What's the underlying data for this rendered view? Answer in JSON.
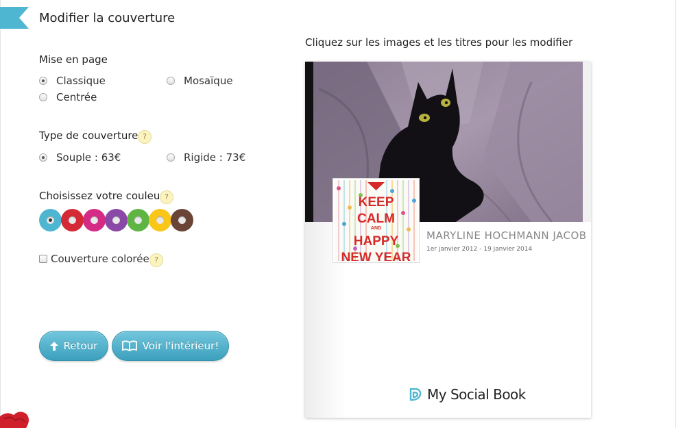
{
  "header": {
    "title": "Modifier la couverture"
  },
  "layout_section": {
    "label": "Mise en page",
    "options": [
      {
        "label": "Classique",
        "selected": true
      },
      {
        "label": "Mosaïque",
        "selected": false
      },
      {
        "label": "Centrée",
        "selected": false
      }
    ]
  },
  "cover_type": {
    "label": "Type de couverture",
    "help": "?",
    "options": [
      {
        "label": "Souple : 63€",
        "selected": true
      },
      {
        "label": "Rigide : 73€",
        "selected": false
      }
    ]
  },
  "color_section": {
    "label": "Choisissez votre couleur",
    "help": "?",
    "colors": [
      "#4fb6d2",
      "#d42a35",
      "#d42b84",
      "#8a48a7",
      "#5fb544",
      "#f9c619",
      "#6a4436"
    ],
    "selected_index": 0
  },
  "colored_cover": {
    "label": "Couverture colorée",
    "help": "?",
    "checked": false
  },
  "buttons": {
    "back": "Retour",
    "view_inside": "Voir l'intérieur!"
  },
  "preview": {
    "hint": "Cliquez sur les images et les titres pour les modifier",
    "book_title": "MARYLINE HOCHMANN JACOB",
    "book_dates": "1er janvier 2012 - 19 janvier 2014",
    "thumbnail_text": [
      "KEEP",
      "CALM",
      "AND",
      "HAPPY",
      "NEW YEAR"
    ],
    "brand": "My Social Book",
    "brand_color": "#4fb6d2"
  }
}
